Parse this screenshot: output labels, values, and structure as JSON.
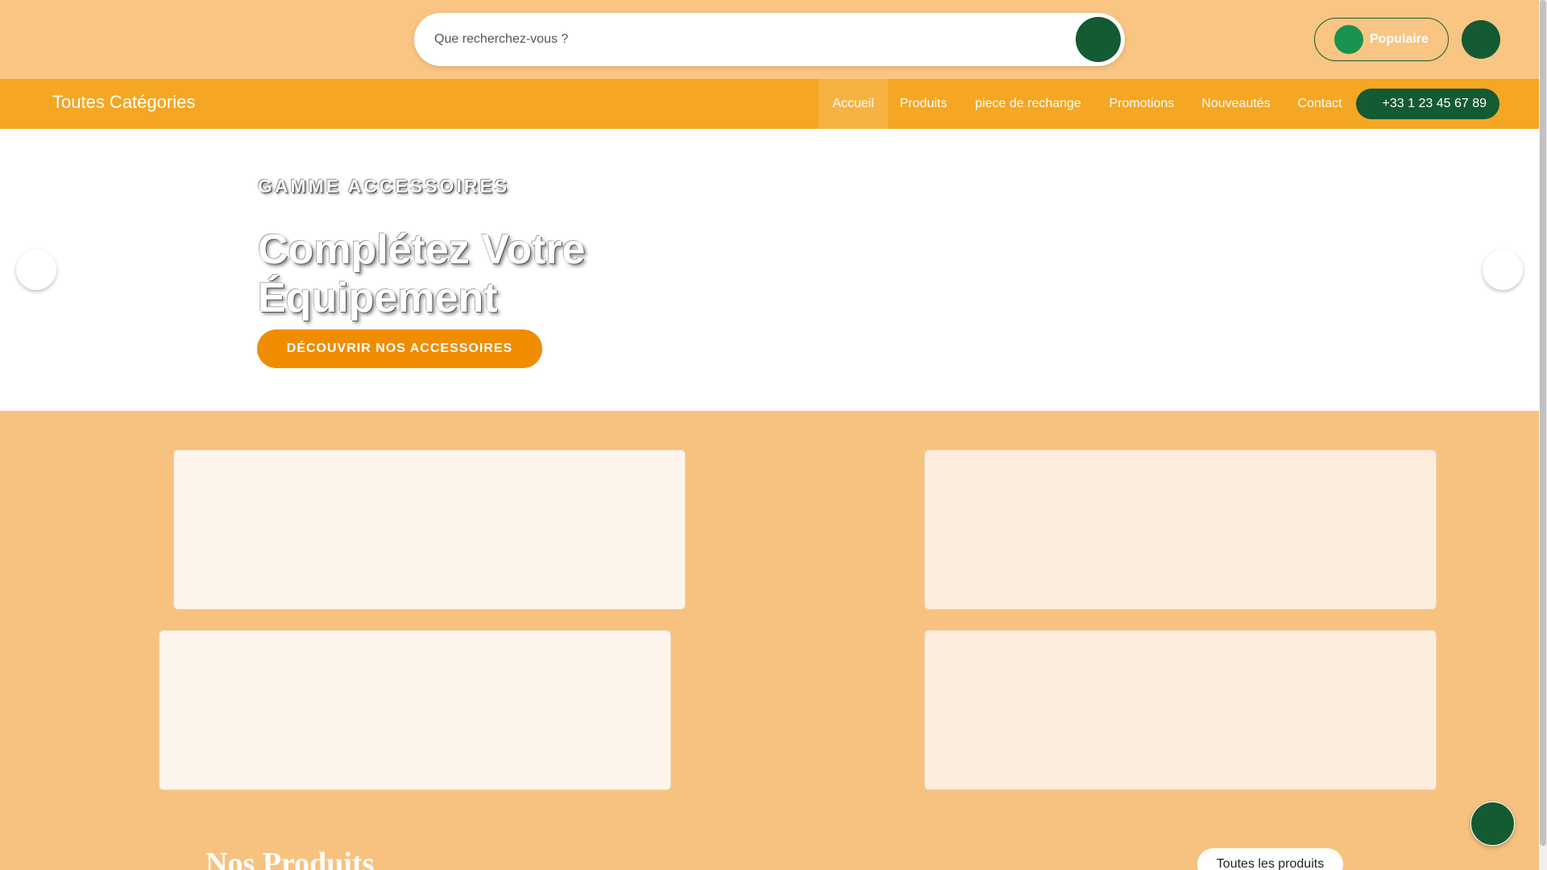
{
  "header": {
    "search": {
      "placeholder": "Que recherchez-vous ?"
    },
    "popular_label": "Populaire"
  },
  "nav": {
    "all_categories": "Toutes Catégories",
    "items": [
      {
        "label": "Accueil",
        "active": true
      },
      {
        "label": "Produits"
      },
      {
        "label": "piece de rechange"
      },
      {
        "label": "Promotions"
      },
      {
        "label": "Nouveautés"
      },
      {
        "label": "Contact"
      }
    ],
    "phone": "+33 1 23 45 67 89"
  },
  "hero": {
    "kicker": "GAMME ACCESSOIRES",
    "title": "Complétez Votre Équipement",
    "cta": "DÉCOUVRIR NOS ACCESSOIRES"
  },
  "products": {
    "title": "Nos Produits",
    "all_link": "Toutes les produits"
  },
  "colors": {
    "brand_green": "#145a32",
    "accent_orange": "#f5a623",
    "cta_orange": "#f08c00",
    "background_peach": "#f7c27f"
  }
}
